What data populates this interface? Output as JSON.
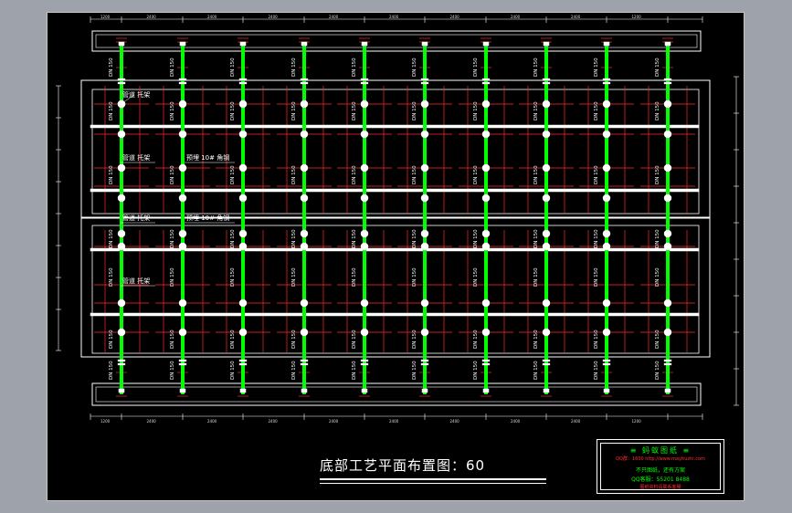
{
  "drawing_title": "底部工艺平面布置图：60",
  "labels": {
    "pipe": "DN 150",
    "bracket": "管道 托架",
    "embed": "预埋 10# 角钢"
  },
  "dims_top": [
    "1200",
    "2400",
    "2400",
    "2400",
    "2400",
    "2400",
    "2400",
    "2400",
    "2400",
    "1200"
  ],
  "dims_bottom": [
    "1200",
    "2400",
    "2400",
    "2400",
    "2400",
    "2400",
    "2400",
    "2400",
    "2400",
    "1200"
  ],
  "title_block": {
    "line1": "≡ 蚂蚁图纸 ≡",
    "line2": "QQ群：1600 http://www.mayituzhi.com",
    "line3": "不只图纸，还有方案",
    "line4": "QQ客服：55201 8488",
    "line5": "图纸资料请联系客服"
  },
  "colors": {
    "pipe": "#00ff00",
    "grid": "#ff2a2a",
    "outline": "#ffffff",
    "background": "#000000"
  }
}
